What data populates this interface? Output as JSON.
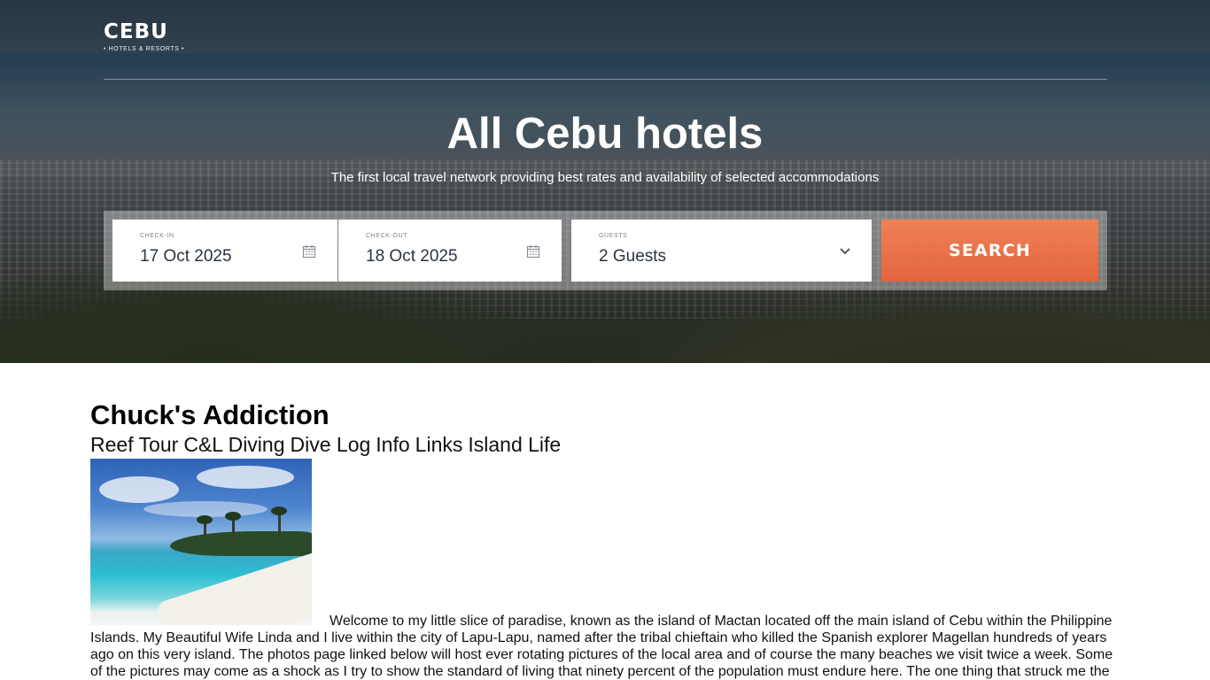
{
  "brand": {
    "name": "CEBU",
    "tagline": "• HOTELS & RESORTS •"
  },
  "hero": {
    "title": "All Cebu hotels",
    "subtitle": "The first local travel network providing best rates and availability of selected accommodations"
  },
  "search": {
    "checkin": {
      "label": "CHECK-IN",
      "value": "17 Oct 2025",
      "icon": "calendar-icon"
    },
    "checkout": {
      "label": "CHECK-OUT",
      "value": "18 Oct 2025",
      "icon": "calendar-icon"
    },
    "guests": {
      "label": "GUESTS",
      "value": "2 Guests",
      "icon": "chevron-down-icon"
    },
    "button_label": "SEARCH",
    "button_color": "#e96d47"
  },
  "page": {
    "title": "Chuck's Addiction",
    "nav": [
      "Reef Tour",
      "C&L Diving",
      "Dive Log",
      "Info",
      "Links",
      "Island Life"
    ],
    "image_alt": "beach-photo",
    "body": "Welcome to my little slice of paradise, known as the island of Mactan located off the main island of Cebu within the Philippine Islands. My Beautiful Wife Linda and I live within the city of Lapu-Lapu, named after the tribal chieftain who killed the Spanish explorer Magellan hundreds of years ago on this very island. The photos page linked below will host ever rotating pictures of the local area and of course the many beaches we visit twice a week. Some of the pictures may come as a shock as I try to show the standard of living that ninety percent of the population must endure here. The one thing that struck me the"
  }
}
